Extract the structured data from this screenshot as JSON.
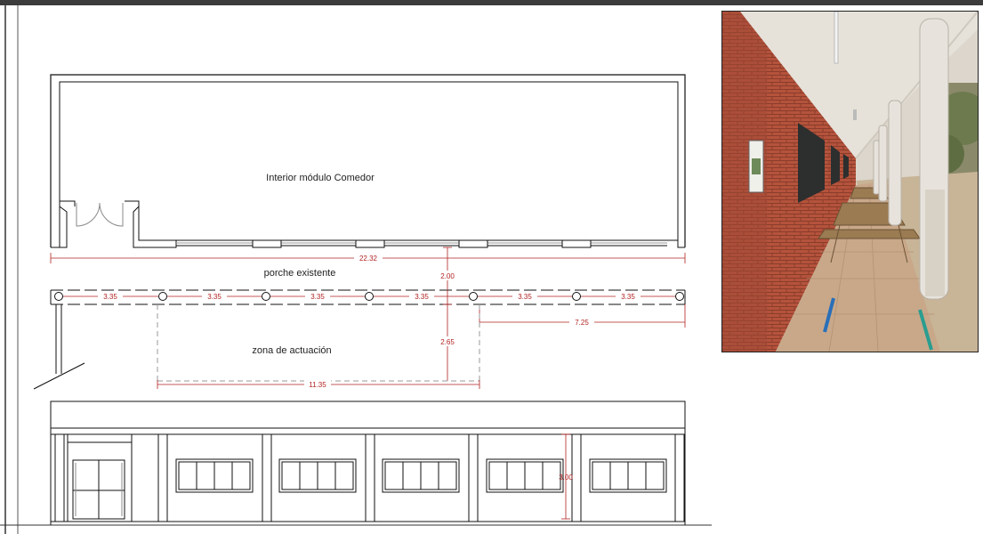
{
  "plan": {
    "room_label": "Interior módulo Comedor",
    "porch_label": "porche existente",
    "zone_label": "zona de actuación",
    "dims": {
      "total_width": "22.32",
      "porch_depth": "2.00",
      "bay": "3.35",
      "zone_depth": "2.65",
      "zone_width": "11.35",
      "right_span": "7.25"
    }
  },
  "elevation": {
    "height_dim": "3.00"
  },
  "colors": {
    "line": "#111111",
    "dimension": "#b22222",
    "brick": "#b5533c",
    "floor": "#c9a88a"
  },
  "photo": {
    "icon": "covered-porch-photo"
  }
}
